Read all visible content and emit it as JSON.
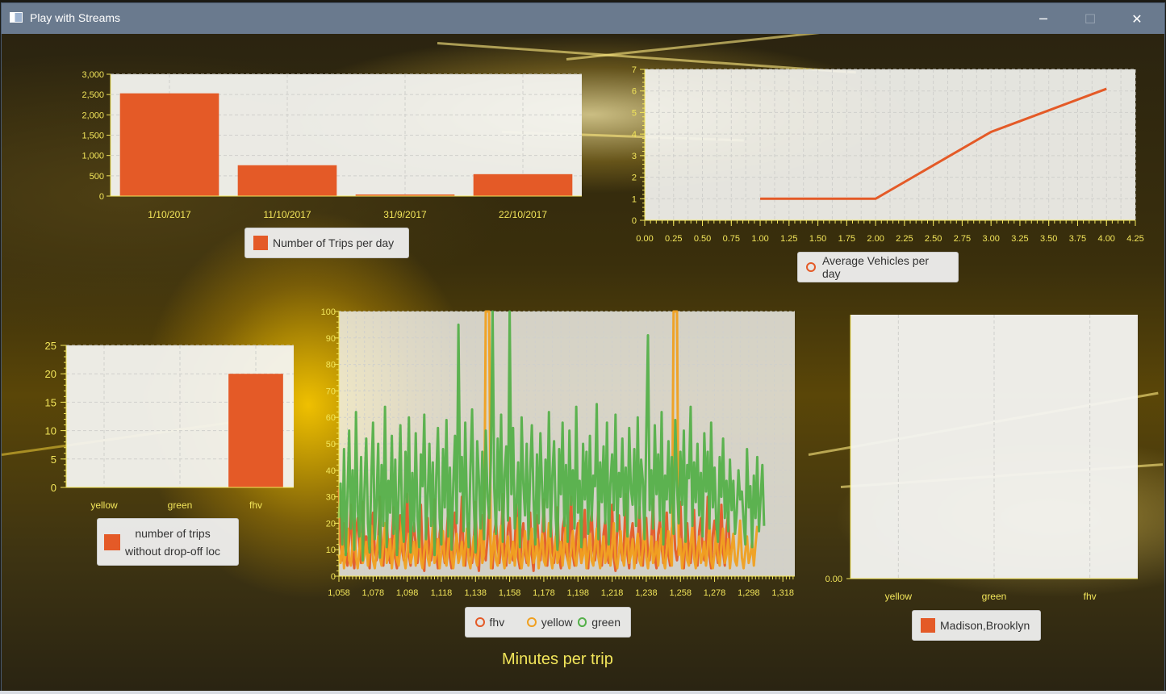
{
  "window": {
    "title": "Play with Streams",
    "controls": {
      "minimize": "─",
      "maximize": "☐",
      "close": "✕"
    }
  },
  "colors": {
    "titlebar": "#6a7a8e",
    "series_fhv": "#e45a27",
    "series_yellow": "#f0a020",
    "series_green": "#55b04a",
    "tick_text": "#f2e55a",
    "plot_bg": "#f4f4f0"
  },
  "charts": {
    "trips_per_day": {
      "legend": "Number of Trips per day"
    },
    "avg_vehicles": {
      "legend": "Average Vehicles per day"
    },
    "no_dropoff": {
      "legend_line1": "number of trips",
      "legend_line2": "without drop-off loc"
    },
    "minutes_per_trip": {
      "legend": [
        "fhv",
        "yellow",
        "green"
      ],
      "axis_title": "Minutes per trip"
    },
    "madison_brooklyn": {
      "legend": "Madison,Brooklyn"
    }
  },
  "chart_data": [
    {
      "id": "trips_per_day",
      "type": "bar",
      "categories": [
        "1/10/2017",
        "11/10/2017",
        "31/9/2017",
        "22/10/2017"
      ],
      "series": [
        {
          "name": "Number of Trips per day",
          "values": [
            2530,
            760,
            40,
            540
          ]
        }
      ],
      "ylim": [
        0,
        3000
      ],
      "yticks": [
        0,
        500,
        1000,
        1500,
        2000,
        2500,
        3000
      ],
      "ytick_labels": [
        "0",
        "500",
        "1,000",
        "1,500",
        "2,000",
        "2,500",
        "3,000"
      ],
      "grid": true,
      "legend_placement": "bottom"
    },
    {
      "id": "avg_vehicles",
      "type": "line",
      "x": [
        1.0,
        2.0,
        3.0,
        4.0
      ],
      "series": [
        {
          "name": "Average Vehicles per day",
          "values": [
            1.0,
            1.0,
            4.1,
            6.1
          ]
        }
      ],
      "xlim": [
        0,
        4.25
      ],
      "ylim": [
        0,
        7
      ],
      "xticks": [
        0.0,
        0.25,
        0.5,
        0.75,
        1.0,
        1.25,
        1.5,
        1.75,
        2.0,
        2.25,
        2.5,
        2.75,
        3.0,
        3.25,
        3.5,
        3.75,
        4.0,
        4.25
      ],
      "xtick_labels": [
        "0.00",
        "0.25",
        "0.50",
        "0.75",
        "1.00",
        "1.25",
        "1.50",
        "1.75",
        "2.00",
        "2.25",
        "2.50",
        "2.75",
        "3.00",
        "3.25",
        "3.50",
        "3.75",
        "4.00",
        "4.25"
      ],
      "yticks": [
        0,
        1,
        2,
        3,
        4,
        5,
        6,
        7
      ],
      "grid": true,
      "legend_placement": "bottom"
    },
    {
      "id": "no_dropoff",
      "type": "bar",
      "categories": [
        "yellow",
        "green",
        "fhv"
      ],
      "series": [
        {
          "name": "number of trips without drop-off loc",
          "values": [
            0,
            0,
            20
          ]
        }
      ],
      "ylim": [
        0,
        25
      ],
      "yticks": [
        0,
        5,
        10,
        15,
        20,
        25
      ],
      "grid": true,
      "legend_placement": "bottom"
    },
    {
      "id": "minutes_per_trip",
      "type": "line",
      "xlim": [
        1058,
        1325
      ],
      "ylim": [
        0,
        100
      ],
      "xticks": [
        1058,
        1078,
        1098,
        1118,
        1138,
        1158,
        1178,
        1198,
        1218,
        1238,
        1258,
        1278,
        1298,
        1318
      ],
      "xtick_labels": [
        "1,058",
        "1,078",
        "1,098",
        "1,118",
        "1,138",
        "1,158",
        "1,178",
        "1,198",
        "1,218",
        "1,238",
        "1,258",
        "1,278",
        "1,298",
        "1,318"
      ],
      "yticks": [
        0,
        10,
        20,
        30,
        40,
        50,
        60,
        70,
        80,
        90,
        100
      ],
      "series": [
        {
          "name": "fhv",
          "x_start": 1058,
          "x_step": 1,
          "values": [
            33,
            12,
            6,
            20,
            9,
            4,
            14,
            27,
            8,
            3,
            17,
            22,
            11,
            5,
            28,
            9,
            15,
            7,
            3,
            19,
            24,
            10,
            6,
            13,
            30,
            8,
            4,
            16,
            21,
            9,
            5,
            12,
            26,
            7,
            3,
            18,
            23,
            10,
            6,
            14,
            31,
            8,
            4,
            15,
            20,
            11,
            5,
            13,
            27,
            7,
            2,
            17,
            22,
            9,
            6,
            12,
            29,
            8,
            3,
            16,
            21,
            10,
            5,
            14,
            25,
            7,
            3,
            18,
            24,
            11,
            6,
            13,
            30,
            8,
            4,
            15,
            20,
            9,
            5,
            12,
            28,
            7,
            2,
            17,
            23,
            10,
            6,
            14,
            26,
            8,
            3,
            16,
            21,
            11,
            5,
            13,
            31,
            9,
            4,
            18,
            22,
            10,
            6,
            12,
            27,
            7,
            3,
            15,
            20,
            9,
            5,
            14,
            24,
            8,
            2,
            17,
            23,
            11,
            6,
            13,
            29,
            8,
            4,
            16,
            21,
            10,
            5,
            12,
            26,
            7,
            3,
            18,
            22,
            9,
            6,
            14,
            30,
            8,
            4,
            15,
            20,
            11,
            5,
            13,
            25,
            7,
            3,
            17,
            24,
            10,
            6,
            12,
            28,
            9,
            4,
            16,
            21,
            8,
            5,
            14,
            27,
            7,
            2,
            18,
            23,
            11,
            6,
            13,
            31,
            8,
            3,
            15,
            20,
            10,
            5,
            12,
            26,
            9,
            4,
            17,
            22,
            8,
            6,
            14,
            29,
            7,
            3,
            16,
            21,
            11,
            5,
            13,
            24,
            8,
            4,
            18,
            23,
            10,
            6,
            12,
            28,
            9,
            3,
            15,
            20,
            8,
            5,
            14,
            25,
            7,
            4,
            17,
            22,
            11,
            6,
            13,
            30,
            8,
            3,
            16,
            21,
            10,
            5,
            12,
            27,
            9,
            4,
            18,
            24,
            8
          ]
        },
        {
          "name": "yellow",
          "x_start": 1058,
          "x_step": 1,
          "values": [
            8,
            5,
            14,
            3,
            9,
            18,
            6,
            4,
            12,
            21,
            7,
            3,
            10,
            16,
            5,
            8,
            13,
            4,
            11,
            19,
            6,
            3,
            9,
            15,
            7,
            4,
            12,
            20,
            5,
            8,
            14,
            3,
            10,
            17,
            6,
            4,
            11,
            22,
            7,
            3,
            9,
            16,
            5,
            8,
            13,
            4,
            12,
            18,
            6,
            3,
            10,
            15,
            7,
            4,
            11,
            19,
            5,
            8,
            14,
            3,
            9,
            17,
            6,
            4,
            12,
            21,
            7,
            3,
            10,
            16,
            5,
            8,
            13,
            4,
            11,
            18,
            6,
            3,
            9,
            15,
            7,
            4,
            12,
            20,
            5,
            8,
            100,
            100,
            100,
            3,
            9,
            16,
            6,
            4,
            12,
            19,
            7,
            3,
            10,
            15,
            5,
            8,
            13,
            4,
            11,
            22,
            6,
            3,
            9,
            17,
            7,
            4,
            12,
            18,
            5,
            8,
            14,
            3,
            10,
            16,
            6,
            4,
            11,
            20,
            7,
            3,
            9,
            15,
            5,
            8,
            13,
            4,
            12,
            19,
            6,
            3,
            10,
            17,
            7,
            4,
            11,
            21,
            5,
            8,
            14,
            3,
            9,
            16,
            6,
            4,
            12,
            18,
            7,
            3,
            10,
            15,
            5,
            8,
            13,
            4,
            11,
            20,
            6,
            3,
            9,
            17,
            7,
            4,
            12,
            19,
            5,
            8,
            14,
            3,
            10,
            16,
            6,
            4,
            11,
            22,
            7,
            3,
            9,
            15,
            5,
            8,
            13,
            4,
            12,
            18,
            6,
            3,
            10,
            17,
            7,
            4,
            100,
            100,
            100,
            8,
            14,
            3,
            9,
            16,
            6,
            4,
            12,
            19,
            7,
            3,
            10,
            15,
            5,
            8,
            13,
            4,
            11,
            20,
            6,
            3,
            9,
            17,
            7,
            4,
            12,
            18,
            5,
            8,
            14,
            3,
            10,
            16,
            6,
            4,
            11,
            21,
            7,
            3,
            9,
            15,
            5,
            8,
            13,
            4,
            12,
            19
          ]
        },
        {
          "name": "green",
          "x_start": 1058,
          "x_step": 1,
          "values": [
            22,
            35,
            12,
            48,
            8,
            30,
            55,
            18,
            40,
            10,
            62,
            25,
            15,
            45,
            6,
            33,
            52,
            20,
            9,
            38,
            58,
            14,
            27,
            50,
            7,
            42,
            19,
            64,
            11,
            36,
            24,
            53,
            16,
            44,
            8,
            31,
            57,
            21,
            13,
            47,
            28,
            60,
            9,
            39,
            17,
            54,
            23,
            11,
            46,
            34,
            61,
            14,
            29,
            50,
            19,
            43,
            8,
            37,
            56,
            22,
            12,
            48,
            26,
            59,
            15,
            41,
            10,
            35,
            53,
            20,
            95,
            32,
            45,
            17,
            58,
            24,
            11,
            40,
            63,
            28,
            9,
            51,
            36,
            18,
            47,
            14,
            55,
            30,
            22,
            44,
            100,
            33,
            16,
            52,
            25,
            61,
            13,
            38,
            49,
            21,
            100,
            31,
            56,
            18,
            27,
            43,
            11,
            60,
            35,
            23,
            50,
            14,
            39,
            57,
            29,
            12,
            46,
            20,
            54,
            33,
            17,
            44,
            26,
            62,
            15,
            38,
            51,
            22,
            10,
            48,
            31,
            58,
            19,
            42,
            13,
            55,
            27,
            40,
            18,
            64,
            24,
            36,
            11,
            50,
            29,
            47,
            16,
            53,
            21,
            38,
            34,
            65,
            14,
            43,
            28,
            49,
            20,
            58,
            12,
            35,
            46,
            25,
            61,
            17,
            39,
            30,
            52,
            23,
            41,
            15,
            56,
            33,
            27,
            48,
            19,
            60,
            22,
            44,
            36,
            14,
            53,
            91,
            25,
            40,
            18,
            57,
            31,
            46,
            21,
            62,
            12,
            38,
            29,
            51,
            24,
            45,
            16,
            59,
            34,
            20,
            47,
            27,
            55,
            13,
            42,
            37,
            64,
            19,
            43,
            28,
            50,
            23,
            39,
            15,
            54,
            32,
            47,
            18,
            58,
            26,
            41,
            20,
            13,
            45,
            30,
            52,
            22,
            36,
            17,
            44,
            25,
            36,
            16,
            24,
            40,
            29,
            32,
            21,
            12,
            48,
            26,
            34,
            11,
            38,
            22,
            45,
            17,
            30,
            42,
            19
          ]
        }
      ],
      "xlabel": "Minutes per trip",
      "grid": true,
      "legend_placement": "bottom"
    },
    {
      "id": "madison_brooklyn",
      "type": "bar",
      "categories": [
        "yellow",
        "green",
        "fhv"
      ],
      "series": [
        {
          "name": "Madison,Brooklyn",
          "values": [
            0,
            0,
            0
          ]
        }
      ],
      "yticks": [
        0
      ],
      "ytick_labels": [
        "0.00"
      ],
      "grid": true,
      "legend_placement": "bottom"
    }
  ]
}
